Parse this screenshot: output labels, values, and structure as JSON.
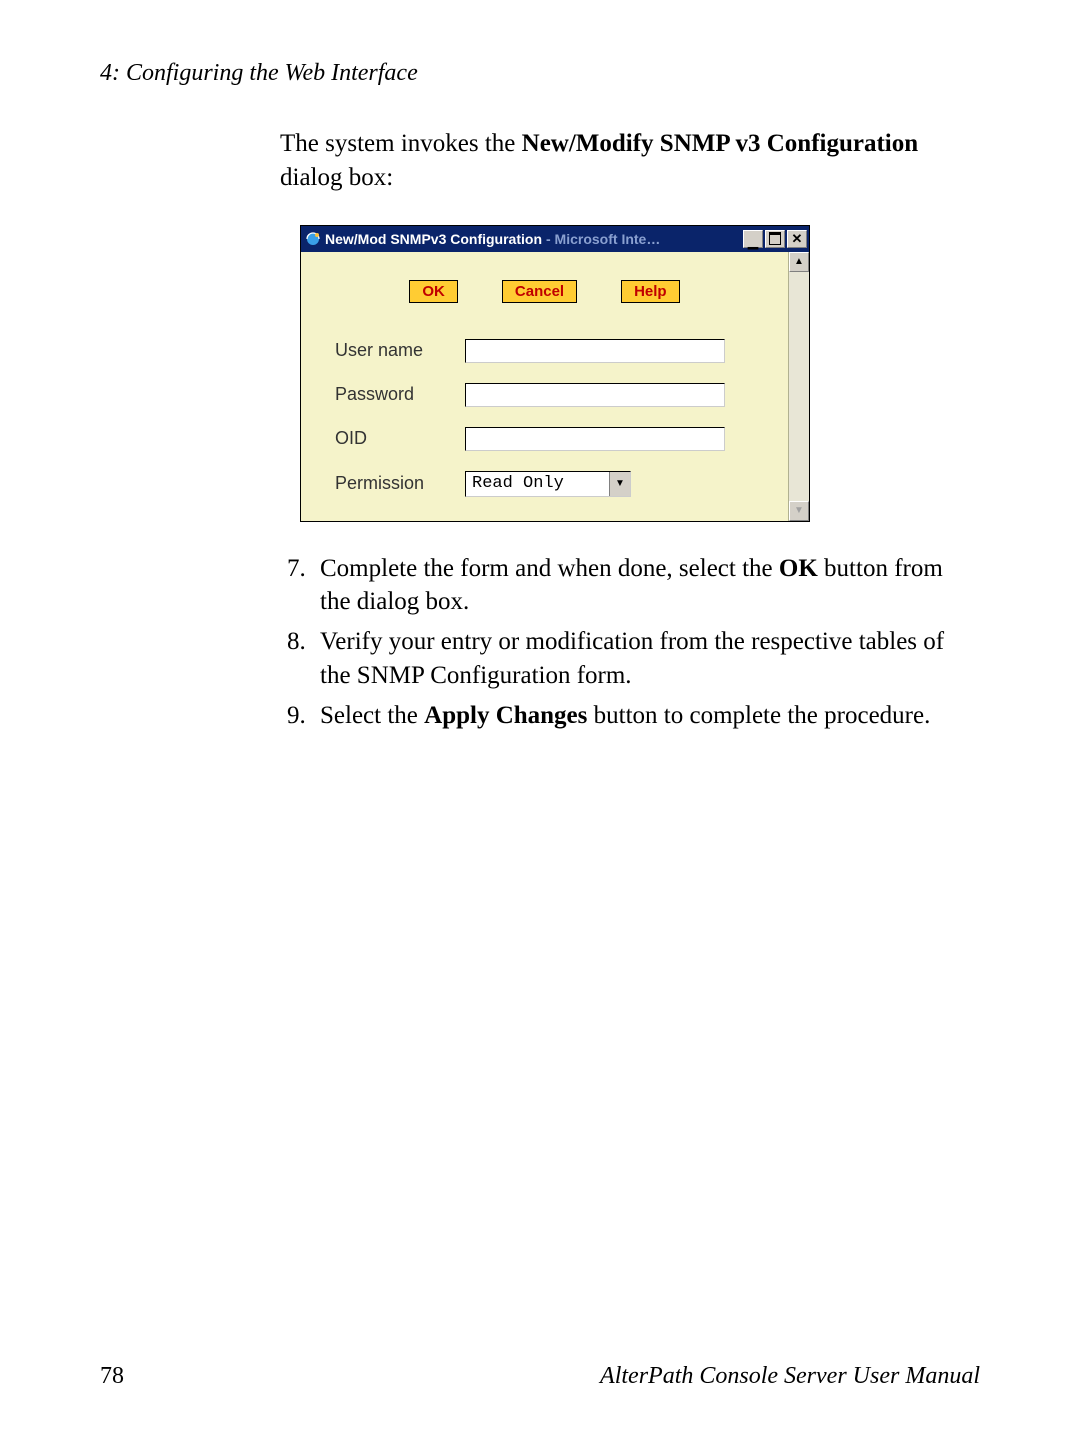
{
  "header": {
    "chapter": "4: Configuring the Web Interface"
  },
  "intro": {
    "prefix": "The system invokes the ",
    "bold": "New/Modify SNMP v3 Configuration",
    "suffix": " dialog box:"
  },
  "dialog": {
    "title_active": "New/Mod SNMPv3 Configuration",
    "title_inactive": " - Microsoft Inte…",
    "buttons": {
      "ok": "OK",
      "cancel": "Cancel",
      "help": "Help"
    },
    "fields": {
      "username_label": "User name",
      "username_value": "",
      "password_label": "Password",
      "password_value": "",
      "oid_label": "OID",
      "oid_value": "",
      "permission_label": "Permission",
      "permission_value": "Read Only"
    }
  },
  "steps": {
    "start": 7,
    "s7_a": "Complete the form and when done, select the ",
    "s7_b": "OK",
    "s7_c": " button from the dialog box.",
    "s8": "Verify your entry or modification from the respective tables of the SNMP Configuration form.",
    "s9_a": "Select the ",
    "s9_b": "Apply Changes",
    "s9_c": " button to complete the procedure."
  },
  "footer": {
    "page": "78",
    "manual": "AlterPath Console Server User Manual"
  }
}
